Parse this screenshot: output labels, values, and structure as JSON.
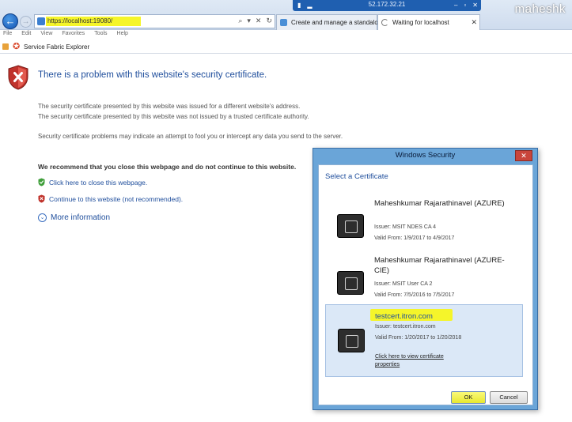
{
  "browser": {
    "remote_ip": "52.172.32.21",
    "watermark": "maheshk",
    "address": "https://localhost:19080/",
    "tabs": [
      {
        "label": "Create and manage a standalo..."
      },
      {
        "label": "Waiting for localhost"
      }
    ],
    "menu": [
      "File",
      "Edit",
      "View",
      "Favorites",
      "Tools",
      "Help"
    ],
    "favorite": "Service Fabric Explorer"
  },
  "page": {
    "title": "There is a problem with this website's security certificate.",
    "line1": "The security certificate presented by this website was issued for a different website's address.",
    "line2": "The security certificate presented by this website was not issued by a trusted certificate authority.",
    "line3": "Security certificate problems may indicate an attempt to fool you or intercept any data you send to the server.",
    "recommend": "We recommend that you close this webpage and do not continue to this website.",
    "link_close": "Click here to close this webpage.",
    "link_continue": "Continue to this website (not recommended).",
    "more_info": "More information"
  },
  "dialog": {
    "title": "Windows Security",
    "heading": "Select a Certificate",
    "certs": [
      {
        "name": "Maheshkumar Rajarathinavel (AZURE)",
        "issuer": "Issuer: MSIT NDES CA 4",
        "valid": "Valid From: 1/9/2017 to 4/9/2017"
      },
      {
        "name": "Maheshkumar Rajarathinavel (AZURE-CIE)",
        "issuer": "Issuer: MSIT User CA 2",
        "valid": "Valid From: 7/5/2016 to 7/5/2017"
      },
      {
        "name": "testcert.itron.com",
        "issuer": "Issuer: testcert.itron.com",
        "valid": "Valid From: 1/20/2017 to 1/20/2018",
        "link": "Click here to view certificate properties"
      }
    ],
    "ok": "OK",
    "cancel": "Cancel"
  },
  "colors": {
    "accent": "#1f4e9c",
    "highlight": "#f5f52a",
    "dialog_frame": "#6aa5d8"
  }
}
